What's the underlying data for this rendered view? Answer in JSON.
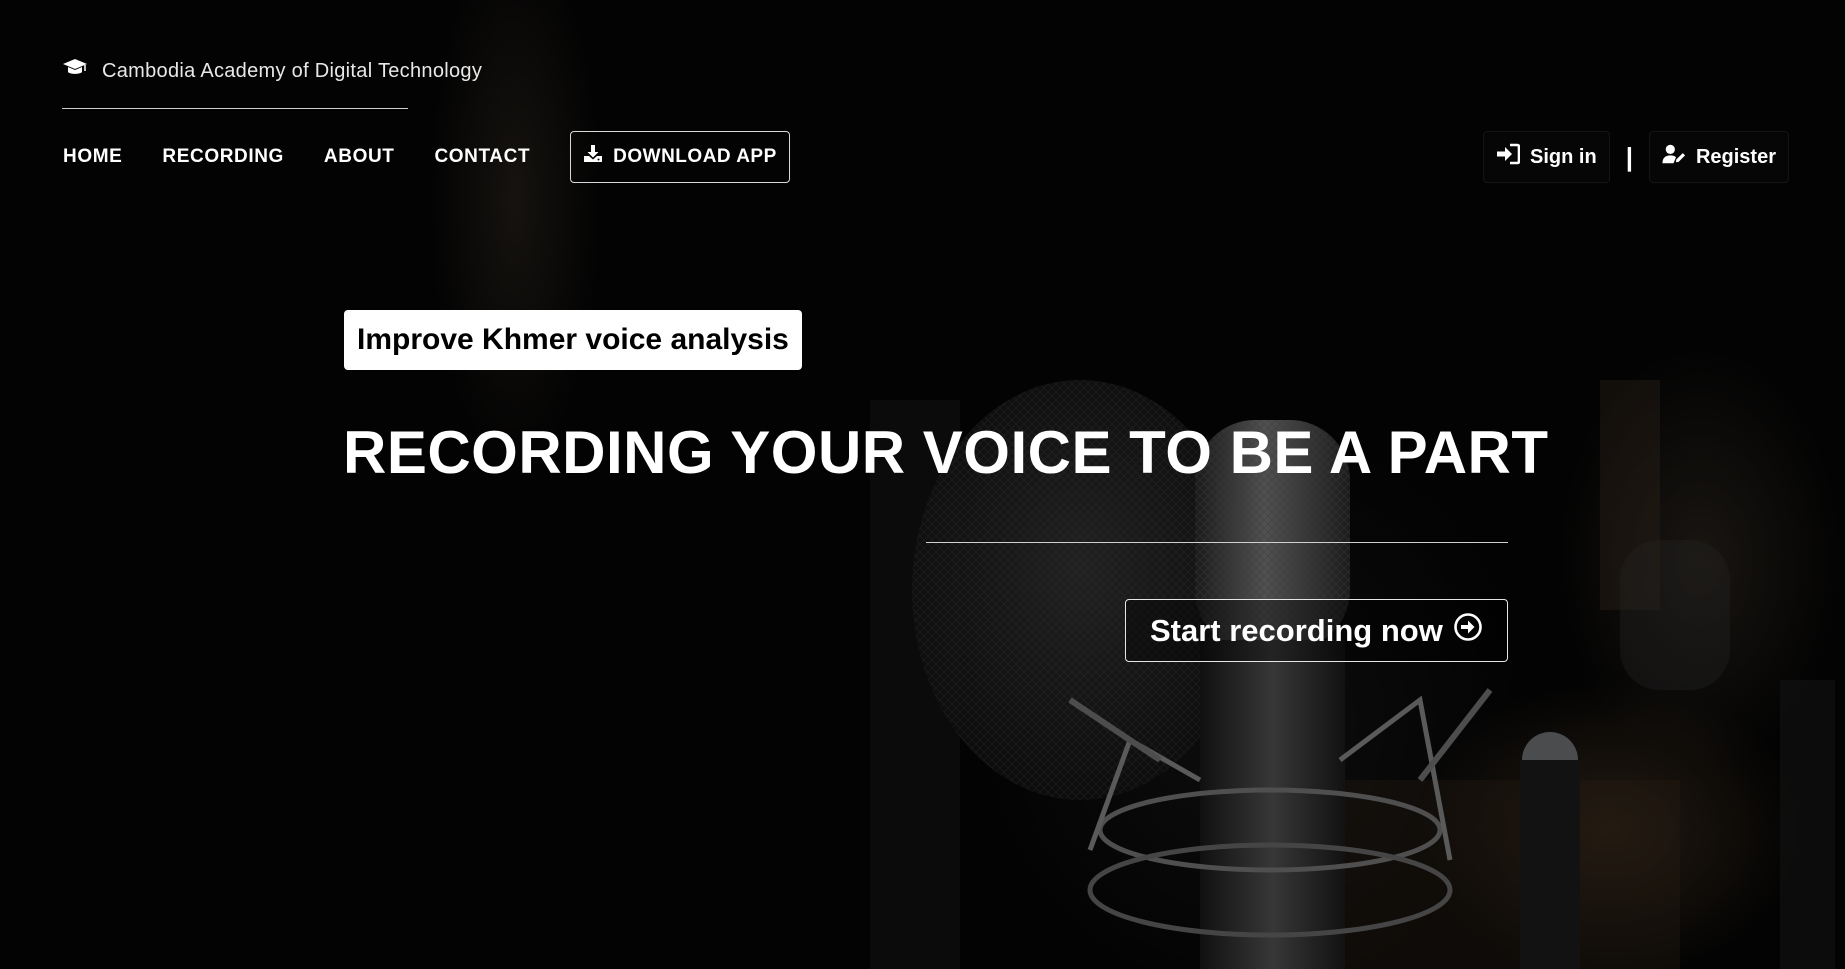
{
  "brand": {
    "name": "Cambodia Academy of Digital Technology",
    "icon": "graduation-cap-icon"
  },
  "nav": {
    "items": [
      {
        "label": "HOME"
      },
      {
        "label": "RECORDING"
      },
      {
        "label": "ABOUT"
      },
      {
        "label": "CONTACT"
      }
    ],
    "download_label": "DOWNLOAD APP",
    "download_icon": "download-icon"
  },
  "auth": {
    "signin_label": "Sign in",
    "signin_icon": "sign-in-icon",
    "separator": "|",
    "register_label": "Register",
    "register_icon": "user-edit-icon"
  },
  "hero": {
    "tag": "Improve Khmer voice analysis",
    "headline": "RECORDING YOUR VOICE TO BE A PART",
    "cta_label": "Start recording now",
    "cta_icon": "arrow-circle-right-icon"
  },
  "colors": {
    "background": "#050505",
    "text": "#ffffff",
    "tag_background": "#ffffff",
    "tag_text": "#000000"
  }
}
